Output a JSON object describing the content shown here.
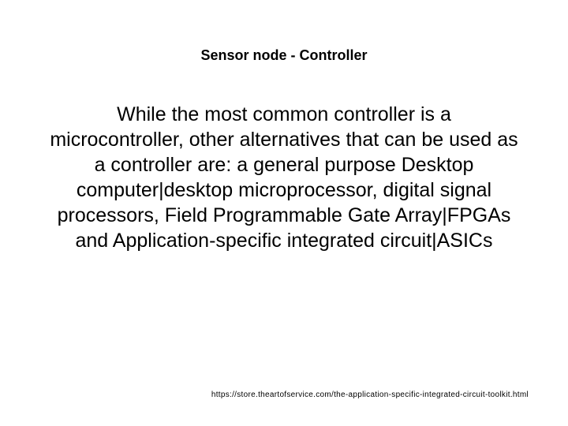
{
  "slide": {
    "title": "Sensor node - Controller",
    "body": "While the most common controller is a microcontroller, other alternatives that can be used as a controller are: a general purpose Desktop computer|desktop microprocessor, digital signal processors, Field Programmable Gate Array|FPGAs and Application-specific integrated circuit|ASICs",
    "footer_url": "https://store.theartofservice.com/the-application-specific-integrated-circuit-toolkit.html"
  }
}
